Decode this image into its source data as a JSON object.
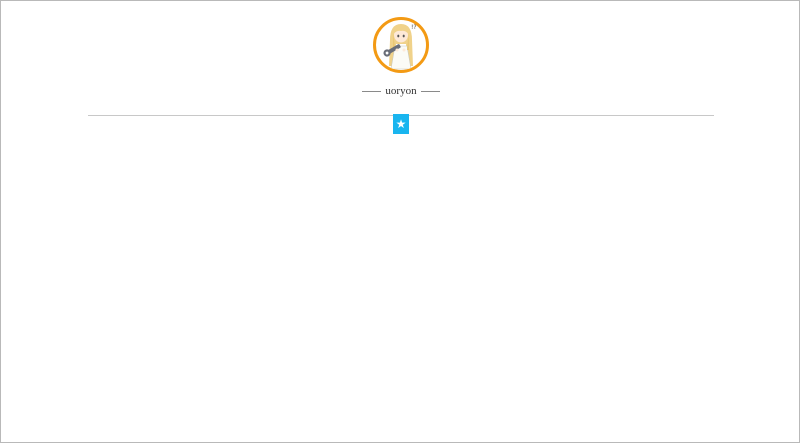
{
  "profile": {
    "username": "uoryon",
    "avatar_icon": "avatar-anime-girl-icon",
    "avatar_border_color": "#f39a14"
  },
  "nav": {
    "star_icon": "★",
    "star_color": "#19b5ef"
  }
}
